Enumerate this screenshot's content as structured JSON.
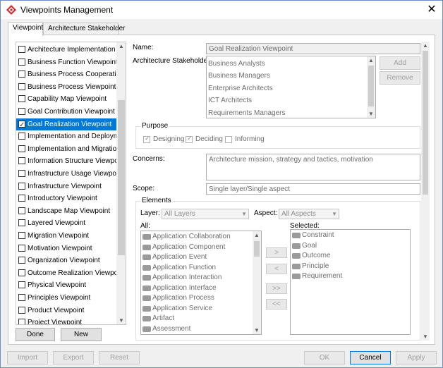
{
  "window": {
    "title": "Viewpoints Management",
    "close_glyph": "✕"
  },
  "tabs": [
    {
      "label": "Viewpoint",
      "active": true
    },
    {
      "label": "Architecture Stakeholder",
      "active": false
    }
  ],
  "viewpoints": [
    {
      "label": "Architecture Implementation a...",
      "checked": false
    },
    {
      "label": "Business Function Viewpoint",
      "checked": false
    },
    {
      "label": "Business Process Cooperation ...",
      "checked": false
    },
    {
      "label": "Business Process Viewpoint",
      "checked": false
    },
    {
      "label": "Capability Map Viewpoint",
      "checked": false
    },
    {
      "label": "Goal Contribution Viewpoint",
      "checked": false
    },
    {
      "label": "Goal Realization Viewpoint",
      "checked": true,
      "selected": true
    },
    {
      "label": "Implementation and Deployme...",
      "checked": false
    },
    {
      "label": "Implementation and Migration ...",
      "checked": false
    },
    {
      "label": "Information Structure Viewpoint",
      "checked": false
    },
    {
      "label": "Infrastructure Usage Viewpoint",
      "checked": false
    },
    {
      "label": "Infrastructure Viewpoint",
      "checked": false
    },
    {
      "label": "Introductory Viewpoint",
      "checked": false
    },
    {
      "label": "Landscape Map Viewpoint",
      "checked": false
    },
    {
      "label": "Layered Viewpoint",
      "checked": false
    },
    {
      "label": "Migration Viewpoint",
      "checked": false
    },
    {
      "label": "Motivation Viewpoint",
      "checked": false
    },
    {
      "label": "Organization Viewpoint",
      "checked": false
    },
    {
      "label": "Outcome Realization Viewpoint",
      "checked": false
    },
    {
      "label": "Physical Viewpoint",
      "checked": false
    },
    {
      "label": "Principles Viewpoint",
      "checked": false
    },
    {
      "label": "Product Viewpoint",
      "checked": false
    },
    {
      "label": "Project Viewpoint",
      "checked": false
    }
  ],
  "left_buttons": {
    "done": "Done",
    "new": "New"
  },
  "form": {
    "name_label": "Name:",
    "name_value": "Goal Realization Viewpoint",
    "stakeholders_label": "Architecture Stakeholders:",
    "stakeholders": [
      "Business Analysts",
      "Business Managers",
      "Enterprise Architects",
      "ICT Architects",
      "Requirements Managers"
    ],
    "add_label": "Add",
    "remove_label": "Remove",
    "purpose_label": "Purpose",
    "purpose_options": [
      {
        "label": "Designing",
        "checked": true
      },
      {
        "label": "Deciding",
        "checked": true
      },
      {
        "label": "Informing",
        "checked": false
      }
    ],
    "concerns_label": "Concerns:",
    "concerns_value": "Architecture mission, strategy and tactics, motivation",
    "scope_label": "Scope:",
    "scope_value": "Single layer/Single aspect"
  },
  "elements": {
    "group_label": "Elements",
    "layer_label": "Layer:",
    "layer_value": "All Layers",
    "aspect_label": "Aspect:",
    "aspect_value": "All Aspects",
    "all_label": "All:",
    "selected_label": "Selected:",
    "all_items": [
      "Application Collaboration",
      "Application Component",
      "Application Event",
      "Application Function",
      "Application Interaction",
      "Application Interface",
      "Application Process",
      "Application Service",
      "Artifact",
      "Assessment"
    ],
    "selected_items": [
      "Constraint",
      "Goal",
      "Outcome",
      "Principle",
      "Requirement"
    ],
    "move_buttons": [
      ">",
      "<",
      ">>",
      "<<"
    ]
  },
  "footer": {
    "import": "Import",
    "export": "Export",
    "reset": "Reset",
    "ok": "OK",
    "cancel": "Cancel",
    "apply": "Apply"
  },
  "colors": {
    "accent": "#0078d7",
    "brand": "#d12b2b"
  }
}
